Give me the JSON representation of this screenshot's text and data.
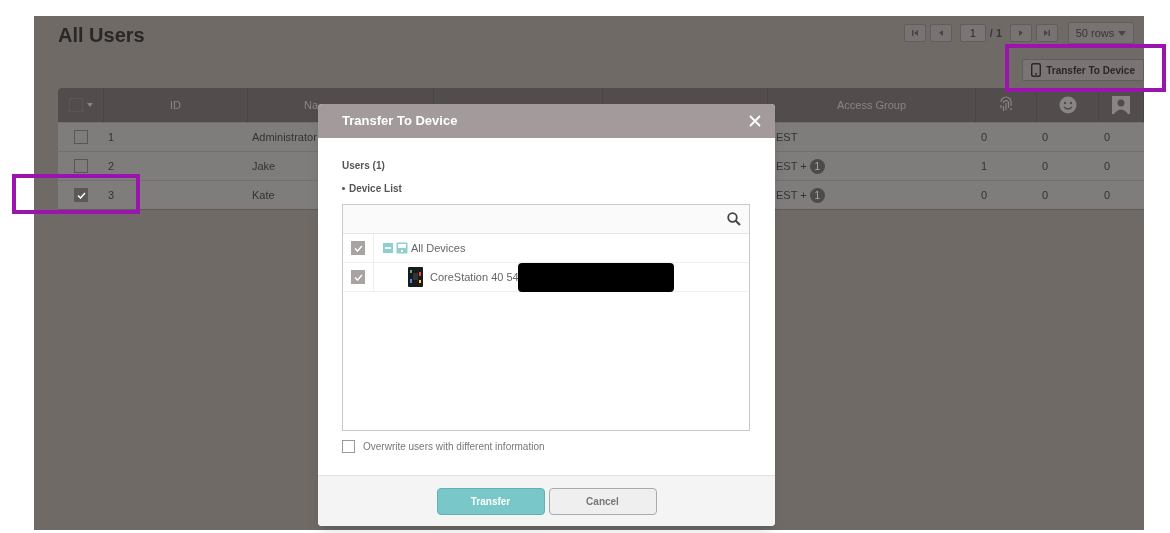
{
  "page": {
    "title": "All Users"
  },
  "pagination": {
    "page": "1",
    "total": "/ 1",
    "rows_per_page": "50 rows"
  },
  "toolbar": {
    "transfer_button": "Transfer To Device"
  },
  "table": {
    "select_all": {
      "checked": false
    },
    "columns": [
      {
        "kind": "text",
        "label": "ID"
      },
      {
        "kind": "text",
        "label": "Na"
      },
      {
        "kind": "blank"
      },
      {
        "kind": "blank"
      },
      {
        "kind": "text",
        "label": "Access Group"
      },
      {
        "kind": "fingerprint"
      },
      {
        "kind": "face"
      },
      {
        "kind": "photo"
      }
    ],
    "rows": [
      {
        "checked": false,
        "id": "1",
        "name": "Administrator",
        "access_group": "EST",
        "fingerprint": "0",
        "face": "0",
        "photo": "0"
      },
      {
        "checked": false,
        "id": "2",
        "name": "Jake",
        "access_group": "EST +",
        "badge": "1",
        "fingerprint": "1",
        "face": "0",
        "photo": "0"
      },
      {
        "checked": true,
        "id": "3",
        "name": "Kate",
        "access_group": "EST +",
        "badge": "1",
        "fingerprint": "0",
        "face": "0",
        "photo": "0"
      }
    ]
  },
  "modal": {
    "title": "Transfer To Device",
    "users_label": "Users (1)",
    "device_list_label": "Device List",
    "tree": [
      {
        "label": "All Devices",
        "checked": true,
        "expanded": true,
        "children": [
          {
            "label": "CoreStation 40 54",
            "checked": true,
            "redacted": true
          }
        ]
      }
    ],
    "overwrite": {
      "label": "Overwrite users with different information",
      "checked": false
    },
    "buttons": [
      {
        "label": "Transfer",
        "kind": "primary"
      },
      {
        "label": "Cancel",
        "kind": "secondary"
      }
    ]
  }
}
